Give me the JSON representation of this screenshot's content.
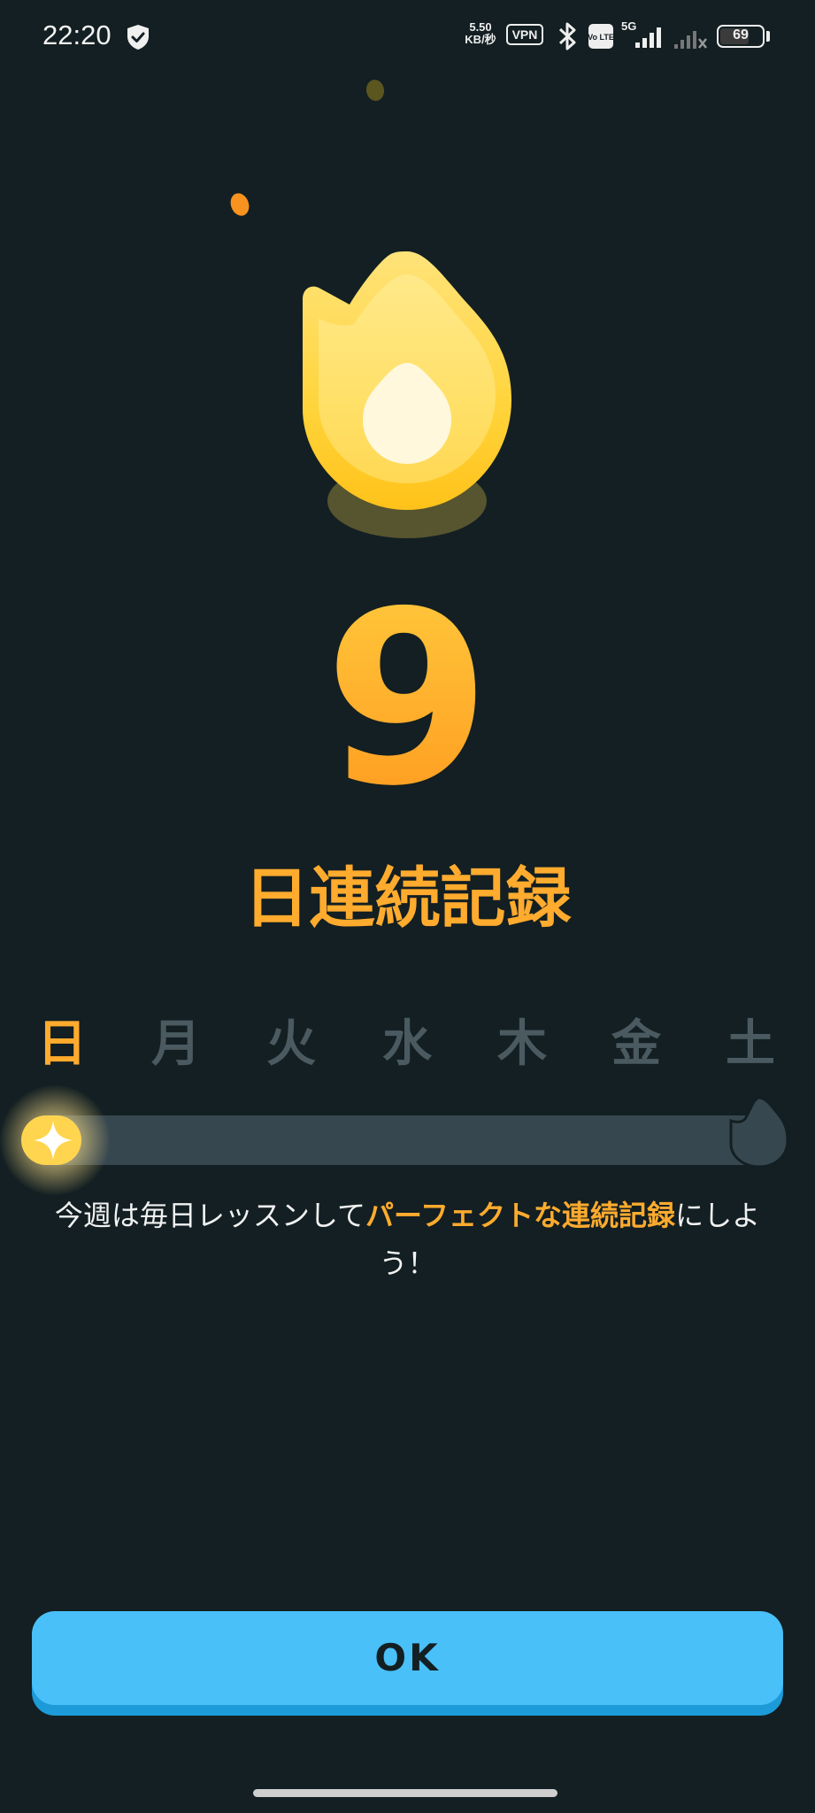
{
  "status_bar": {
    "time": "22:20",
    "net_speed_value": "5.50",
    "net_speed_unit": "KB/秒",
    "vpn_label": "VPN",
    "volte_label": "Vo LTE",
    "network_label": "5G",
    "battery_level": "69",
    "battery_fraction": 0.69,
    "icons": [
      "shield-check-icon",
      "bluetooth-icon",
      "volte-icon",
      "signal-icon",
      "signal-off-icon",
      "battery-icon"
    ]
  },
  "streak": {
    "count": "9",
    "title": "日連続記録"
  },
  "week": {
    "days": [
      {
        "label": "日",
        "active": true
      },
      {
        "label": "月",
        "active": false
      },
      {
        "label": "火",
        "active": false
      },
      {
        "label": "水",
        "active": false
      },
      {
        "label": "木",
        "active": false
      },
      {
        "label": "金",
        "active": false
      },
      {
        "label": "土",
        "active": false
      }
    ],
    "completed_days": 1
  },
  "message": {
    "part1": "今週は毎日レッスンして",
    "highlight": "パーフェクトな連続記録",
    "part2": "にしよう！"
  },
  "ok_button": {
    "label": "OK"
  },
  "colors": {
    "background": "#131f22",
    "accent_orange": "#ffab2e",
    "flame_yellow": "#ffd54f",
    "button_blue": "#49c0f8",
    "inactive_gray": "#4a5a60",
    "track": "#37474f"
  }
}
